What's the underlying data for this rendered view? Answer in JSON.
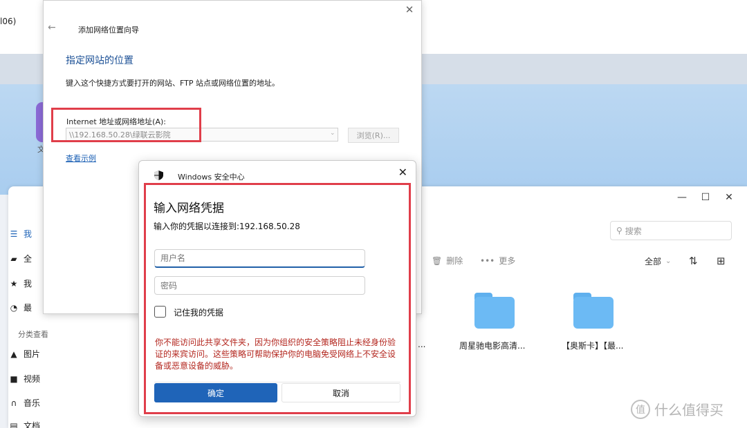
{
  "background": {
    "title_fragment": "l06)",
    "app_icon_label": "文",
    "window_controls": {
      "minimize": "—",
      "maximize": "☐",
      "close": "✕"
    },
    "sidebar": {
      "items": [
        {
          "label": "我",
          "icon": "list-icon"
        },
        {
          "label": "全",
          "icon": "folder-icon"
        },
        {
          "label": "我",
          "icon": "star-icon"
        },
        {
          "label": "最",
          "icon": "clock-icon"
        }
      ],
      "section_label": "分类查看",
      "category_items": [
        {
          "label": "图片",
          "icon": "image-icon"
        },
        {
          "label": "视频",
          "icon": "video-icon"
        },
        {
          "label": "音乐",
          "icon": "headphones-icon"
        },
        {
          "label": "文档",
          "icon": "document-icon"
        }
      ]
    },
    "search_placeholder": "搜索",
    "toolbar": {
      "delete_label": "删除",
      "more_label": "更多"
    },
    "filter_label": "全部",
    "folders": [
      {
        "label": "周星驰电影高清..."
      },
      {
        "label": "【奥斯卡】【最..."
      }
    ],
    "folder_label_left_fragment": "...",
    "watermark": "什么值得买"
  },
  "wizard": {
    "title": "添加网络位置向导",
    "heading": "指定网站的位置",
    "description": "键入这个快捷方式要打开的网站、FTP 站点或网络位置的地址。",
    "address_label": "Internet 地址或网络地址(A):",
    "address_value": "\\\\192.168.50.28\\绿联云影院",
    "browse_label": "浏览(R)...",
    "example_link": "查看示例"
  },
  "security": {
    "title": "Windows 安全中心",
    "heading": "输入网络凭据",
    "subtitle": "输入你的凭据以连接到:192.168.50.28",
    "username_placeholder": "用户名",
    "password_placeholder": "密码",
    "remember_label": "记住我的凭据",
    "error_message": "你不能访问此共享文件夹，因为你组织的安全策略阻止未经身份验证的来宾访问。这些策略可帮助保护你的电脑免受网络上不安全设备或恶意设备的威胁。",
    "ok_label": "确定",
    "cancel_label": "取消"
  },
  "colors": {
    "highlight_box": "#e03e4a",
    "primary_button": "#1f64b8",
    "error_text": "#b3261e",
    "heading_blue": "#1a4f95",
    "folder_blue": "#6cbaf4"
  }
}
